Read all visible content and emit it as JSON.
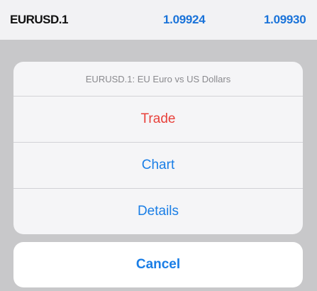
{
  "quote": {
    "symbol": "EURUSD.1",
    "bid": "1.09924",
    "ask": "1.09930"
  },
  "action_sheet": {
    "title": "EURUSD.1: EU Euro vs US Dollars",
    "actions": [
      {
        "label": "Trade"
      },
      {
        "label": "Chart"
      },
      {
        "label": "Details"
      }
    ],
    "cancel_label": "Cancel"
  },
  "colors": {
    "accent": "#1a7ee6",
    "destructive": "#e8413b",
    "price": "#1a73d9"
  }
}
